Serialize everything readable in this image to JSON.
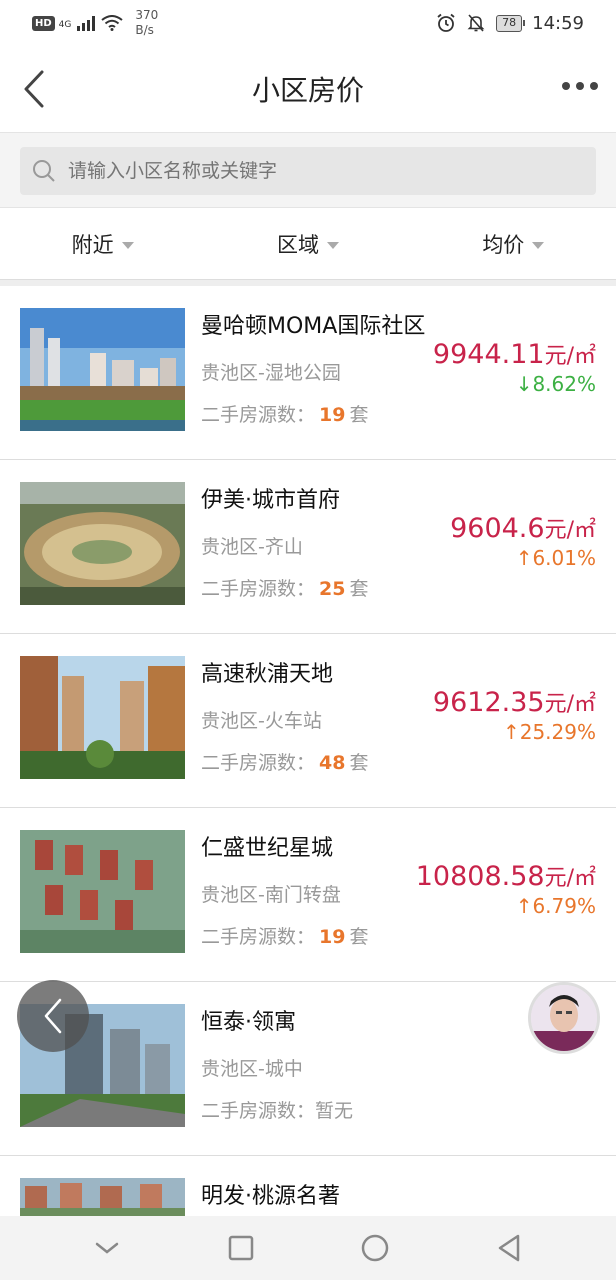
{
  "status_bar": {
    "hd": "HD",
    "network": "4G",
    "speed_value": "370",
    "speed_unit": "B/s",
    "battery": "78",
    "time": "14:59"
  },
  "header": {
    "title": "小区房价"
  },
  "search": {
    "placeholder": "请输入小区名称或关键字"
  },
  "filters": [
    {
      "label": "附近"
    },
    {
      "label": "区域"
    },
    {
      "label": "均价"
    }
  ],
  "listings": [
    {
      "name": "曼哈顿MOMA国际社区",
      "area": "贵池区-湿地公园",
      "count_label": "二手房源数：",
      "count": "19",
      "count_unit": "套",
      "price": "9944.11",
      "price_unit": "元/㎡",
      "change": "↓8.62%",
      "trend": "down"
    },
    {
      "name": "伊美·城市首府",
      "area": "贵池区-齐山",
      "count_label": "二手房源数：",
      "count": "25",
      "count_unit": "套",
      "price": "9604.6",
      "price_unit": "元/㎡",
      "change": "↑6.01%",
      "trend": "up"
    },
    {
      "name": "高速秋浦天地",
      "area": "贵池区-火车站",
      "count_label": "二手房源数：",
      "count": "48",
      "count_unit": "套",
      "price": "9612.35",
      "price_unit": "元/㎡",
      "change": "↑25.29%",
      "trend": "up"
    },
    {
      "name": "仁盛世纪星城",
      "area": "贵池区-南门转盘",
      "count_label": "二手房源数：",
      "count": "19",
      "count_unit": "套",
      "price": "10808.58",
      "price_unit": "元/㎡",
      "change": "↑6.79%",
      "trend": "up"
    },
    {
      "name": "恒泰·领寓",
      "area": "贵池区-城中",
      "count_label": "二手房源数：",
      "count_none": "暂无"
    },
    {
      "name": "明发·桃源名著"
    }
  ],
  "colors": {
    "price": "#c8234a",
    "up": "#e8762c",
    "down": "#3cb043",
    "count": "#e8762c"
  }
}
